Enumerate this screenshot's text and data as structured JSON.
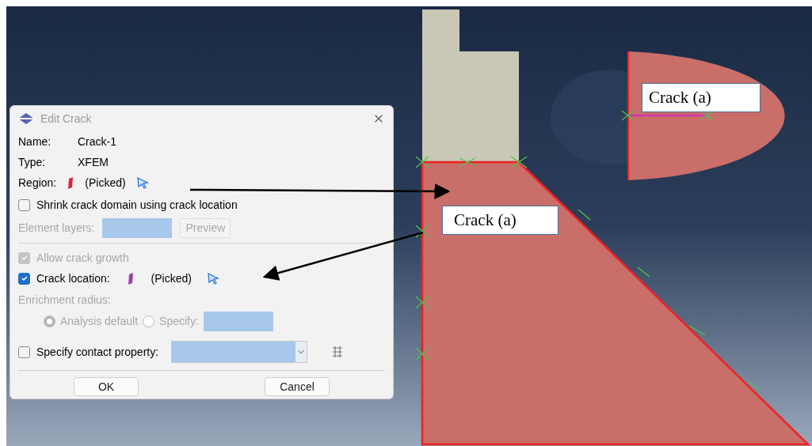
{
  "dialog": {
    "title": "Edit Crack",
    "name": {
      "label": "Name:",
      "value": "Crack-1"
    },
    "type": {
      "label": "Type:",
      "value": "XFEM"
    },
    "region": {
      "label": "Region:",
      "value": "(Picked)"
    },
    "shrink": {
      "label": "Shrink crack domain using crack location",
      "checked": false
    },
    "element_layers": {
      "label": "Element layers:",
      "button": "Preview",
      "disabled": true
    },
    "allow_growth": {
      "label": "Allow crack growth",
      "checked": true,
      "disabled": true
    },
    "crack_location": {
      "label": "Crack location:",
      "value": "(Picked)",
      "checked": true
    },
    "enrichment": {
      "label": "Enrichment radius:",
      "disabled": true,
      "options": [
        {
          "label": "Analysis default",
          "selected": true
        },
        {
          "label": "Specify:",
          "selected": false
        }
      ]
    },
    "contact": {
      "label": "Specify contact property:",
      "checked": false
    },
    "buttons": [
      "OK",
      "Cancel"
    ]
  },
  "annotations": [
    "Crack (a)",
    "Crack (a)"
  ]
}
